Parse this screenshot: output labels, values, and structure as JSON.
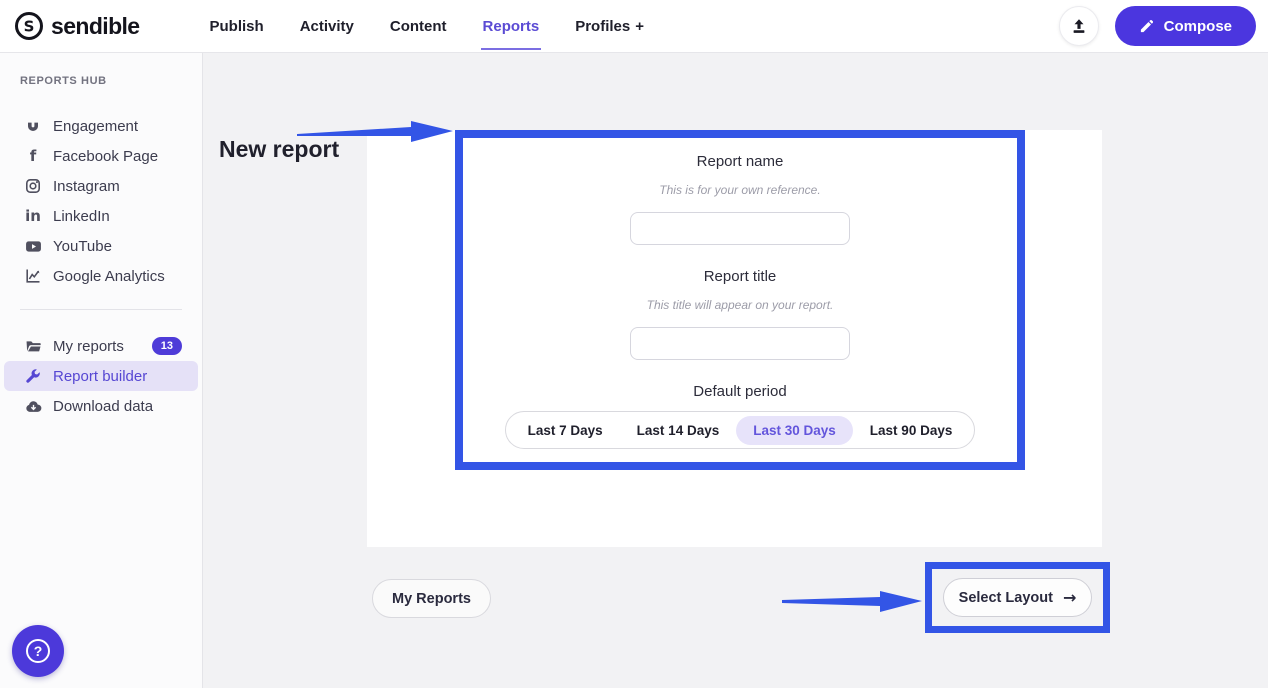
{
  "brand": {
    "name": "sendible"
  },
  "topnav": {
    "items": [
      "Publish",
      "Activity",
      "Content",
      "Reports",
      "Profiles"
    ],
    "active_item": "Reports",
    "profiles_plus": "+",
    "compose_label": "Compose"
  },
  "sidebar": {
    "section_title": "REPORTS HUB",
    "report_items": [
      {
        "label": "Engagement",
        "icon": "magnet-icon"
      },
      {
        "label": "Facebook Page",
        "icon": "facebook-icon"
      },
      {
        "label": "Instagram",
        "icon": "instagram-icon"
      },
      {
        "label": "LinkedIn",
        "icon": "linkedin-icon"
      },
      {
        "label": "YouTube",
        "icon": "youtube-icon"
      },
      {
        "label": "Google Analytics",
        "icon": "analytics-icon"
      }
    ],
    "tool_items": [
      {
        "label": "My reports",
        "icon": "folder-icon",
        "badge": "13"
      },
      {
        "label": "Report builder",
        "icon": "wrench-icon",
        "active": true
      },
      {
        "label": "Download data",
        "icon": "cloud-download-icon"
      }
    ],
    "facebook_glyph": "f",
    "linkedin_glyph": "in"
  },
  "main": {
    "page_title": "New report",
    "form": {
      "name_label": "Report name",
      "name_hint": "This is for your own reference.",
      "name_value": "",
      "title_label": "Report title",
      "title_hint": "This title will appear on your report.",
      "title_value": "",
      "period_label": "Default period",
      "period_options": [
        "Last 7 Days",
        "Last 14 Days",
        "Last 30 Days",
        "Last 90 Days"
      ],
      "period_selected": "Last 30 Days"
    },
    "footer": {
      "back_button": "My Reports",
      "next_button": "Select Layout",
      "next_arrow": "→"
    },
    "help_glyph": "?"
  },
  "colors": {
    "brand_purple": "#4b36df",
    "accent_purple_text": "#5b4bd4",
    "annotation_blue": "#3355e6",
    "badge_purple": "#4e3bd8",
    "selected_pill_bg": "#e7e3fa",
    "active_row_bg": "#e5e1f7"
  }
}
